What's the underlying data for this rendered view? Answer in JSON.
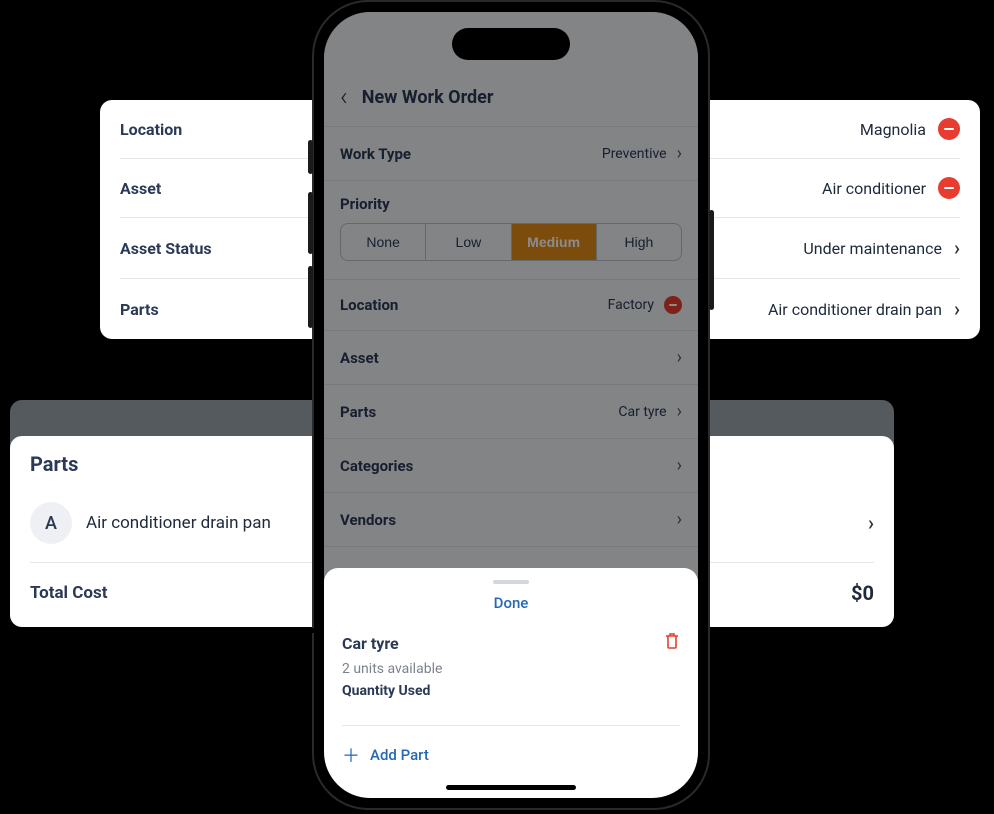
{
  "behind_top": {
    "rows": [
      {
        "label": "Location",
        "value": "Magnolia",
        "right_type": "minus"
      },
      {
        "label": "Asset",
        "value": "Air conditioner",
        "right_type": "minus"
      },
      {
        "label": "Asset Status",
        "value": "Under maintenance",
        "right_type": "chevron"
      },
      {
        "label": "Parts",
        "value": "Air conditioner drain pan",
        "right_type": "chevron"
      }
    ]
  },
  "behind_bottom": {
    "title": "Parts",
    "avatar_letter": "A",
    "part_name": "Air conditioner drain pan",
    "total_label": "Total Cost",
    "total_value": "$0"
  },
  "phone": {
    "title": "New Work Order",
    "work_type_label": "Work Type",
    "work_type_value": "Preventive",
    "priority_label": "Priority",
    "priority_options": [
      "None",
      "Low",
      "Medium",
      "High"
    ],
    "priority_selected": "Medium",
    "location_label": "Location",
    "location_value": "Factory",
    "asset_label": "Asset",
    "parts_label": "Parts",
    "parts_value": "Car tyre",
    "categories_label": "Categories",
    "vendors_label": "Vendors"
  },
  "sheet": {
    "done": "Done",
    "item_name": "Car tyre",
    "availability": "2 units available",
    "qty_label": "Quantity Used",
    "add_part": "Add Part"
  }
}
